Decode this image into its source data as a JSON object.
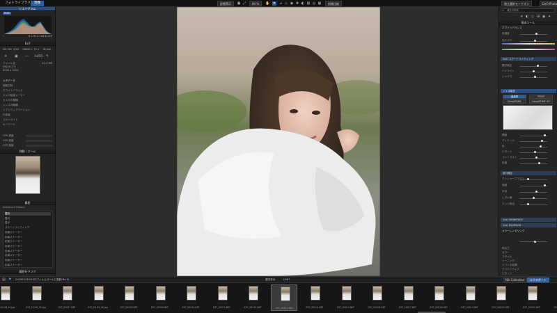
{
  "topbar": {
    "tabs": [
      "フォトライブラリ",
      "現像"
    ],
    "zoom_label": "80 %",
    "mode_a": "詳細表示",
    "mode_b": "前後比較",
    "right_a": "独立選択モードオン",
    "right_b": "DxO PhotoLab"
  },
  "left": {
    "hist_title": "ヒストグラム",
    "hist_mode": "RGB",
    "hist_readout": "R 176  G 166  B 159",
    "exif_title": "Exif",
    "exif_values": [
      "ISO 100",
      "1/1/0",
      "1/8000 s",
      "F1.4",
      "85 mm"
    ],
    "file_name": "ファイル名",
    "file_size": "44.4 MB",
    "camera": "NIKON Z 8",
    "dimensions": "8256 x 5504",
    "meta_title": "メタデータ",
    "meta_rows": [
      {
        "k": "撮影日時",
        "v": "2023/04/02 14:08:42"
      },
      {
        "k": "ホワイトバランス",
        "v": "自動"
      },
      {
        "k": "カメラ製造メーカー",
        "v": "NIKON CORPORATION"
      },
      {
        "k": "カメラの機種",
        "v": "NIKON Z 8"
      },
      {
        "k": "レンズの機種",
        "v": "85mm f/1.4"
      },
      {
        "k": "ソフトウェアバージョン",
        "v": "NIKON Z 8 Ver.01.00"
      },
      {
        "k": "作成者",
        "v": "—"
      },
      {
        "k": "コピーライト",
        "v": "—"
      },
      {
        "k": "キーワード",
        "v": "—"
      }
    ],
    "gps_rows": [
      "GPS 緯度",
      "GPS 経度",
      "GPS 高度"
    ],
    "nav_title": "移動 / ズーム",
    "history_title": "履歴",
    "history_sub": "Advanced History",
    "history_items": [
      {
        "label": "露光",
        "value": "0.4"
      },
      {
        "label": "露光",
        "value": "0.37"
      },
      {
        "label": "露光",
        "value": "0.34"
      },
      {
        "label": "スマートライティング",
        "value": ""
      },
      {
        "label": "前景スケーター",
        "value": ""
      },
      {
        "label": "前景スケーター",
        "value": ""
      },
      {
        "label": "前景スケーター",
        "value": ""
      },
      {
        "label": "前景スケーター",
        "value": ""
      },
      {
        "label": "前景スケーター",
        "value": ""
      },
      {
        "label": "前景スケーター",
        "value": ""
      },
      {
        "label": "前景スケーター",
        "value": ""
      },
      {
        "label": "前景スケーター",
        "value": ""
      }
    ],
    "save_btn": "履歴をクリア",
    "footer": "プロジェクトフォルダ"
  },
  "right": {
    "search_placeholder": "補正の検索",
    "tool_title": "基本ツール",
    "wb_title": "ホワイトバランス",
    "wb_rows": [
      {
        "k": "色温度",
        "v": "5300"
      },
      {
        "k": "色かぶり",
        "v": "0"
      }
    ],
    "dxo_title": "DxO スマートライティング",
    "exposure_rows": [
      {
        "k": "露光補正",
        "v": "0.40"
      },
      {
        "k": "ハイライト",
        "v": "-10"
      },
      {
        "k": "シャドウ",
        "v": "0"
      }
    ],
    "denoise_title": "ノイズ除去",
    "denoise_opts": [
      "高品質",
      "PRIME",
      "DeepPRIME",
      "DeepPRIME XD"
    ],
    "adjust_rows": [
      {
        "k": "輝度",
        "v": "100"
      },
      {
        "k": "ディテール",
        "v": "0"
      },
      {
        "k": "色",
        "v": "0"
      },
      {
        "k": "ビネット",
        "v": "0"
      },
      {
        "k": "コントラスト",
        "v": "0"
      },
      {
        "k": "彩度",
        "v": "0"
      }
    ],
    "mask_title": "部分補正",
    "mask_rows": [
      {
        "k": "アンシャープマスク",
        "v": ""
      },
      {
        "k": "強度",
        "v": "100"
      },
      {
        "k": "半径",
        "v": "0.50"
      },
      {
        "k": "しきい値",
        "v": "4"
      },
      {
        "k": "エッジ検出",
        "v": ""
      }
    ],
    "sec_a": "DxO VIEWPOINT",
    "sec_b": "DxO FILMPACK",
    "sec_c": "カラーレンダリング",
    "tail_rows": [
      "明るさ",
      "カラー",
      "スタイル",
      "トーニング",
      "ソフトな色調",
      "クリエイティブ",
      "ビネット"
    ]
  },
  "filmstrip": {
    "path": "D:\\DXO\\Z8 0402\\フィルムロールに登録(No.9)",
    "center_label": "選択済み",
    "count": "1/467",
    "collection_btn": "Nik Collection",
    "export_btn": "エクスポート",
    "thumbs": [
      {
        "name": "Z97_00-96_94.jpg",
        "selected": false
      },
      {
        "name": "Z97_00-96_95.jpg",
        "selected": false
      },
      {
        "name": "Z97_00007.NEF",
        "selected": false
      },
      {
        "name": "Z97_00-96_96.jpg",
        "selected": false
      },
      {
        "name": "Z97_00008.NEF",
        "selected": false
      },
      {
        "name": "Z97_00009.NEF",
        "selected": false
      },
      {
        "name": "Z97_00010.NEF",
        "selected": false
      },
      {
        "name": "Z97_00011.NEF",
        "selected": false
      },
      {
        "name": "Z97_00012.NEF",
        "selected": false
      },
      {
        "name": "Z97_00013.NEF",
        "selected": true
      },
      {
        "name": "Z97_00014.NEF",
        "selected": false
      },
      {
        "name": "Z97_00015.NEF",
        "selected": false
      },
      {
        "name": "Z97_00016.NEF",
        "selected": false
      },
      {
        "name": "Z97_00017.NEF",
        "selected": false
      },
      {
        "name": "Z97_00018.NEF",
        "selected": false
      },
      {
        "name": "Z97_00019.NEF",
        "selected": false
      },
      {
        "name": "Z97_00020.NEF",
        "selected": false
      },
      {
        "name": "Z97_00021.NEF",
        "selected": false
      },
      {
        "name": "Z97_00022.NEF",
        "selected": false
      }
    ]
  }
}
